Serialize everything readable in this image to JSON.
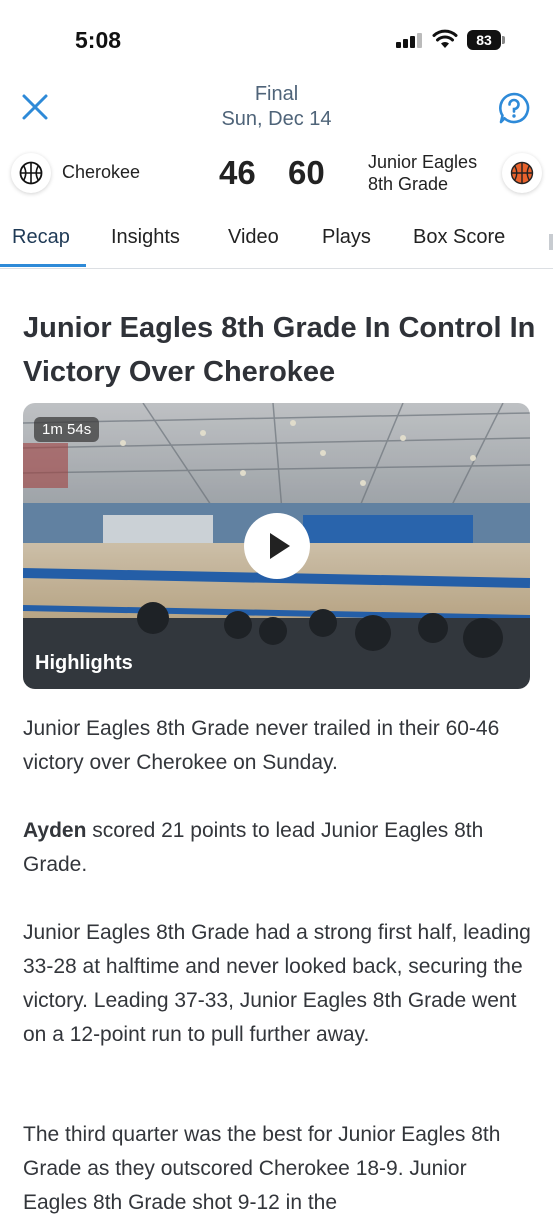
{
  "status_bar": {
    "time": "5:08",
    "battery": "83"
  },
  "header": {
    "game_status": "Final",
    "date": "Sun, Dec 14"
  },
  "teams": {
    "home": {
      "name": "Cherokee",
      "score": "46"
    },
    "away": {
      "name_line1": "Junior Eagles",
      "name_line2": "8th Grade",
      "score": "60"
    }
  },
  "tabs": [
    {
      "label": "Recap"
    },
    {
      "label": "Insights"
    },
    {
      "label": "Video"
    },
    {
      "label": "Plays"
    },
    {
      "label": "Box Score"
    }
  ],
  "article": {
    "headline": "Junior Eagles 8th Grade In Control In Victory Over Cherokee",
    "video": {
      "duration": "1m 54s",
      "label": "Highlights"
    },
    "p1": "Junior Eagles 8th Grade never trailed in their 60-46 victory over Cherokee on Sunday.",
    "p2_bold": "Ayden",
    "p2_rest": " scored 21 points to lead Junior Eagles 8th Grade.",
    "p3": "Junior Eagles 8th Grade had a strong first half, leading 33-28 at halftime and never looked back, securing the victory. Leading 37-33, Junior Eagles 8th Grade went on a 12-point run to pull further away.",
    "p4": "The third quarter was the best for Junior Eagles 8th Grade as they outscored Cherokee 18-9. Junior Eagles 8th Grade shot 9-12 in the"
  },
  "colors": {
    "accent": "#2e8ad8",
    "header_text": "#4f6479"
  }
}
